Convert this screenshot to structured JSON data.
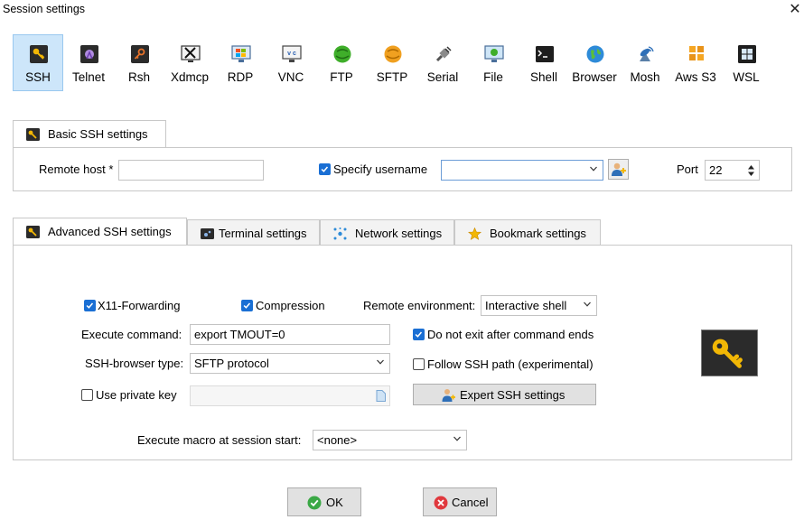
{
  "window": {
    "title": "Session settings",
    "close_glyph": "✕"
  },
  "protocols": [
    {
      "label": "SSH",
      "icon": "ssh-icon",
      "selected": true
    },
    {
      "label": "Telnet",
      "icon": "telnet-icon"
    },
    {
      "label": "Rsh",
      "icon": "rsh-icon"
    },
    {
      "label": "Xdmcp",
      "icon": "xdmcp-icon"
    },
    {
      "label": "RDP",
      "icon": "rdp-icon"
    },
    {
      "label": "VNC",
      "icon": "vnc-icon"
    },
    {
      "label": "FTP",
      "icon": "ftp-icon"
    },
    {
      "label": "SFTP",
      "icon": "sftp-icon"
    },
    {
      "label": "Serial",
      "icon": "serial-icon"
    },
    {
      "label": "File",
      "icon": "file-icon"
    },
    {
      "label": "Shell",
      "icon": "shell-icon"
    },
    {
      "label": "Browser",
      "icon": "browser-icon"
    },
    {
      "label": "Mosh",
      "icon": "mosh-icon"
    },
    {
      "label": "Aws S3",
      "icon": "aws-s3-icon"
    },
    {
      "label": "WSL",
      "icon": "wsl-icon"
    }
  ],
  "basic": {
    "tab_label": "Basic SSH settings",
    "remote_host_label": "Remote host *",
    "remote_host_value": "",
    "specify_username_label": "Specify username",
    "specify_username_checked": true,
    "username_value": "",
    "port_label": "Port",
    "port_value": "22"
  },
  "tabs": [
    {
      "label": "Advanced SSH settings",
      "icon": "wrench-icon",
      "active": true
    },
    {
      "label": "Terminal settings",
      "icon": "terminal-icon"
    },
    {
      "label": "Network settings",
      "icon": "network-icon"
    },
    {
      "label": "Bookmark settings",
      "icon": "star-icon"
    }
  ],
  "advanced": {
    "x11_label": "X11-Forwarding",
    "x11_checked": true,
    "compression_label": "Compression",
    "compression_checked": true,
    "remote_env_label": "Remote environment:",
    "remote_env_value": "Interactive shell",
    "execute_command_label": "Execute command:",
    "execute_command_value": "export TMOUT=0",
    "do_not_exit_label": "Do not exit after command ends",
    "do_not_exit_checked": true,
    "ssh_browser_label": "SSH-browser type:",
    "ssh_browser_value": "SFTP protocol",
    "follow_ssh_label": "Follow SSH path (experimental)",
    "follow_ssh_checked": false,
    "private_key_label": "Use private key",
    "private_key_checked": false,
    "private_key_value": "",
    "expert_button_label": "Expert SSH settings",
    "macro_label": "Execute macro at session start:",
    "macro_value": "<none>"
  },
  "footer": {
    "ok_label": "OK",
    "cancel_label": "Cancel"
  },
  "colors": {
    "selected_bg": "#cde6fa",
    "checkbox_blue": "#1a6fd4",
    "key_gold": "#f2b705"
  }
}
